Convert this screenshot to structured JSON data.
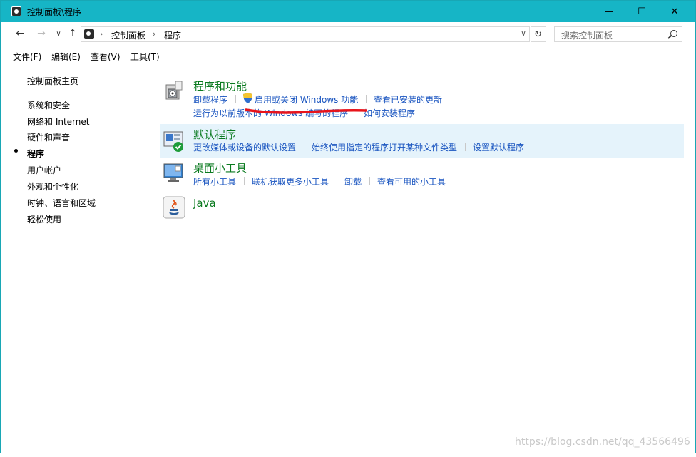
{
  "window": {
    "title": "控制面板\\程序",
    "minimize_glyph": "—",
    "maximize_glyph": "☐",
    "close_glyph": "✕"
  },
  "address": {
    "crumbs": [
      "控制面板",
      "程序"
    ],
    "search_placeholder": "搜索控制面板"
  },
  "menu": [
    "文件(F)",
    "编辑(E)",
    "查看(V)",
    "工具(T)"
  ],
  "sidebar": {
    "home": "控制面板主页",
    "items": [
      "系统和安全",
      "网络和 Internet",
      "硬件和声音",
      "程序",
      "用户帐户",
      "外观和个性化",
      "时钟、语言和区域",
      "轻松使用"
    ],
    "active_index": 3
  },
  "categories": {
    "programs": {
      "title": "程序和功能",
      "links": [
        "卸载程序",
        "启用或关闭 Windows 功能",
        "查看已安装的更新",
        "运行为以前版本的 Windows 编写的程序",
        "如何安装程序"
      ]
    },
    "defaults": {
      "title": "默认程序",
      "links": [
        "更改媒体或设备的默认设置",
        "始终使用指定的程序打开某种文件类型",
        "设置默认程序"
      ]
    },
    "gadgets": {
      "title": "桌面小工具",
      "links": [
        "所有小工具",
        "联机获取更多小工具",
        "卸载",
        "查看可用的小工具"
      ]
    },
    "java": {
      "title": "Java"
    }
  },
  "watermark": "https://blog.csdn.net/qq_43566496",
  "colors": {
    "titlebar": "#16b5c6",
    "category_title": "#0a7a1f",
    "link": "#1a55c0",
    "highlight": "#e5f3fb",
    "annotation": "#e8141b"
  }
}
